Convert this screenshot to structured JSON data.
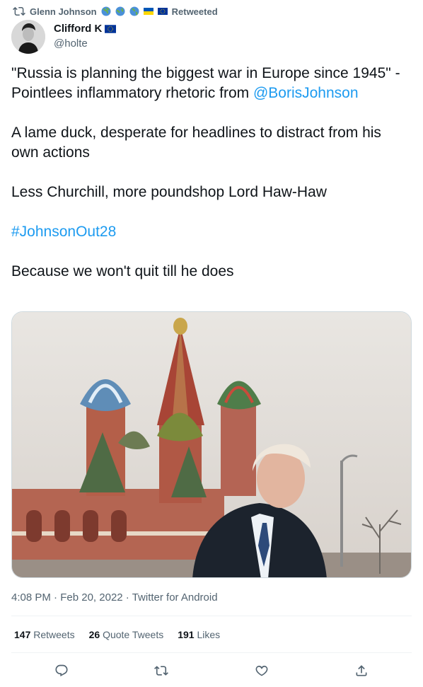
{
  "retweet": {
    "retweeter": "Glenn Johnson",
    "label": "Retweeted"
  },
  "author": {
    "name": "Clifford K",
    "handle": "@holte"
  },
  "tweet": {
    "p1_before": "\"Russia is planning the biggest war in Europe since 1945\" - Pointlees inflammatory rhetoric from ",
    "mention": "@BorisJohnson",
    "p2": "A lame duck, desperate for headlines to distract from his own actions",
    "p3": "Less Churchill, more poundshop Lord Haw-Haw",
    "hashtag": "#JohnsonOut28",
    "p5": "Because we won't quit till he does"
  },
  "meta": {
    "time": "4:08 PM",
    "sep": " · ",
    "date": "Feb 20, 2022",
    "sep2": " · ",
    "source": "Twitter for Android"
  },
  "stats": {
    "retweets_count": "147",
    "retweets_label": "Retweets",
    "quotes_count": "26",
    "quotes_label": "Quote Tweets",
    "likes_count": "191",
    "likes_label": "Likes"
  },
  "colors": {
    "accent": "#1d9bf0",
    "secondary": "#536471"
  },
  "icons": [
    "retweet-icon",
    "globe-icon",
    "ukraine-flag-icon",
    "eu-flag-icon",
    "reply-icon",
    "like-icon",
    "share-icon"
  ]
}
